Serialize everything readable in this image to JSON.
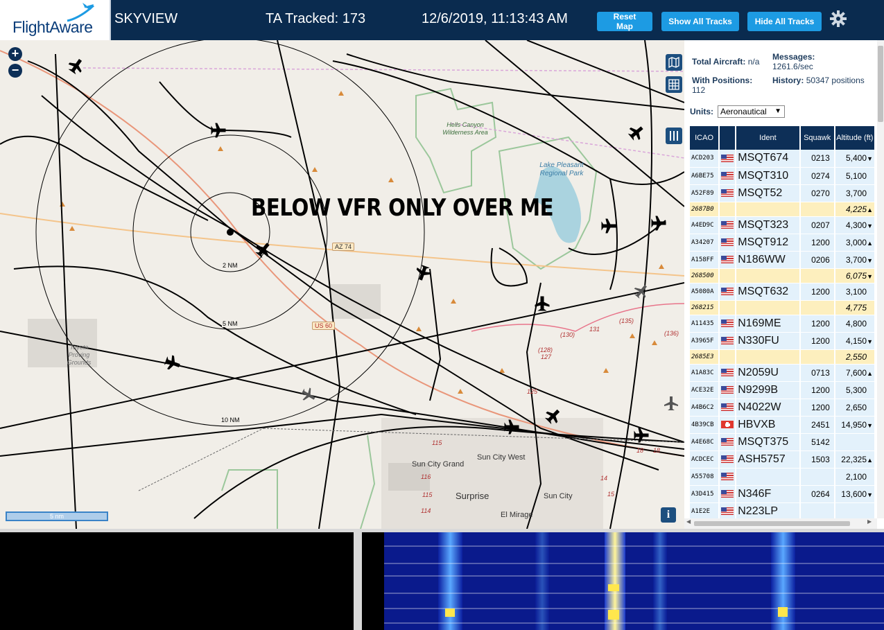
{
  "header": {
    "brand": "FlightAware",
    "title": "SKYVIEW",
    "tracked": "TA Tracked: 173",
    "datetime": "12/6/2019, 11:13:43 AM",
    "buttons": {
      "reset": "Reset Map",
      "show_all": "Show All Tracks",
      "hide_all": "Hide All Tracks"
    },
    "icons": {
      "settings": "gear-icon",
      "logo": "plane-logo-icon"
    }
  },
  "map": {
    "overlay_text": "BELOW VFR ONLY OVER ME",
    "zoom_in": "+",
    "zoom_out": "−",
    "scale": "5 nm",
    "info": "i",
    "rings": [
      "2 NM",
      "5 NM",
      "10 NM"
    ],
    "places": {
      "hells_canyon": "Hells Canyon Wilderness Area",
      "lake_pleasant": "Lake Pleasant Regional Park",
      "toyota": "Toyota Proving Grounds",
      "sun_city_grand": "Sun City Grand",
      "sun_city_west": "Sun City West",
      "surprise": "Surprise",
      "sun_city": "Sun City",
      "el_mirage": "El Mirage"
    },
    "highways": [
      "AZ 74",
      "US 60"
    ],
    "route_numbers": [
      "131",
      "(135)",
      "(130)",
      "(136)",
      "(128)",
      "127",
      "125",
      "115",
      "116",
      "115",
      "114",
      "18",
      "18",
      "14",
      "15"
    ]
  },
  "sidebar": {
    "total_aircraft_label": "Total Aircraft:",
    "total_aircraft_value": "n/a",
    "with_positions_label": "With Positions:",
    "with_positions_value": "112",
    "messages_label": "Messages:",
    "messages_value": "1261.6/sec",
    "history_label": "History:",
    "history_value": "50347 positions",
    "units_label": "Units:",
    "units_value": "Aeronautical",
    "table_headers": {
      "icao": "ICAO",
      "ident": "Ident",
      "squawk": "Squawk",
      "altitude": "Altitude (ft)"
    },
    "rows": [
      {
        "icao": "ACD203",
        "flag": "us",
        "ident": "MSQT674",
        "squawk": "0213",
        "alt": "5,400",
        "trend": "▼",
        "nopos": false
      },
      {
        "icao": "A6BE75",
        "flag": "us",
        "ident": "MSQT310",
        "squawk": "0274",
        "alt": "5,100",
        "trend": "",
        "nopos": false
      },
      {
        "icao": "A52F89",
        "flag": "us",
        "ident": "MSQT52",
        "squawk": "0270",
        "alt": "3,700",
        "trend": "",
        "nopos": false
      },
      {
        "icao": "2687B0",
        "flag": "",
        "ident": "",
        "squawk": "",
        "alt": "4,225",
        "trend": "▲",
        "nopos": true
      },
      {
        "icao": "A4ED9C",
        "flag": "us",
        "ident": "MSQT323",
        "squawk": "0207",
        "alt": "4,300",
        "trend": "▼",
        "nopos": false
      },
      {
        "icao": "A34207",
        "flag": "us",
        "ident": "MSQT912",
        "squawk": "1200",
        "alt": "3,000",
        "trend": "▲",
        "nopos": false
      },
      {
        "icao": "A158FF",
        "flag": "us",
        "ident": "N186WW",
        "squawk": "0206",
        "alt": "3,700",
        "trend": "▼",
        "nopos": false
      },
      {
        "icao": "268500",
        "flag": "",
        "ident": "",
        "squawk": "",
        "alt": "6,075",
        "trend": "▼",
        "nopos": true
      },
      {
        "icao": "A5080A",
        "flag": "us",
        "ident": "MSQT632",
        "squawk": "1200",
        "alt": "3,100",
        "trend": "",
        "nopos": false
      },
      {
        "icao": "268215",
        "flag": "",
        "ident": "",
        "squawk": "",
        "alt": "4,775",
        "trend": "",
        "nopos": true
      },
      {
        "icao": "A11435",
        "flag": "us",
        "ident": "N169ME",
        "squawk": "1200",
        "alt": "4,800",
        "trend": "",
        "nopos": false
      },
      {
        "icao": "A3965F",
        "flag": "us",
        "ident": "N330FU",
        "squawk": "1200",
        "alt": "4,150",
        "trend": "▼",
        "nopos": false
      },
      {
        "icao": "2685E3",
        "flag": "",
        "ident": "",
        "squawk": "",
        "alt": "2,550",
        "trend": "",
        "nopos": true
      },
      {
        "icao": "A1A83C",
        "flag": "us",
        "ident": "N2059U",
        "squawk": "0713",
        "alt": "7,600",
        "trend": "▲",
        "nopos": false
      },
      {
        "icao": "ACE32E",
        "flag": "us",
        "ident": "N9299B",
        "squawk": "1200",
        "alt": "5,300",
        "trend": "",
        "nopos": false
      },
      {
        "icao": "A4B6C2",
        "flag": "us",
        "ident": "N4022W",
        "squawk": "1200",
        "alt": "2,650",
        "trend": "",
        "nopos": false
      },
      {
        "icao": "4B39CB",
        "flag": "ch",
        "ident": "HBVXB",
        "squawk": "2451",
        "alt": "14,950",
        "trend": "▼",
        "nopos": false
      },
      {
        "icao": "A4E68C",
        "flag": "us",
        "ident": "MSQT375",
        "squawk": "5142",
        "alt": "",
        "trend": "",
        "nopos": false
      },
      {
        "icao": "ACDCEC",
        "flag": "us",
        "ident": "ASH5757",
        "squawk": "1503",
        "alt": "22,325",
        "trend": "▲",
        "nopos": false
      },
      {
        "icao": "A55708",
        "flag": "us",
        "ident": "",
        "squawk": "",
        "alt": "2,100",
        "trend": "",
        "nopos": false
      },
      {
        "icao": "A3D415",
        "flag": "us",
        "ident": "N346F",
        "squawk": "0264",
        "alt": "13,600",
        "trend": "▼",
        "nopos": false
      },
      {
        "icao": "A1E2E",
        "flag": "us",
        "ident": "N223LP",
        "squawk": "",
        "alt": "",
        "trend": "",
        "nopos": false
      }
    ]
  },
  "colors": {
    "header_bg": "#0a2b4f",
    "button_bg": "#1d9be3",
    "table_header": "#0d2f57",
    "row_bg": "#e3f1fb",
    "nopos_row_bg": "#fdefbe",
    "map_bg": "#f1eee8"
  }
}
